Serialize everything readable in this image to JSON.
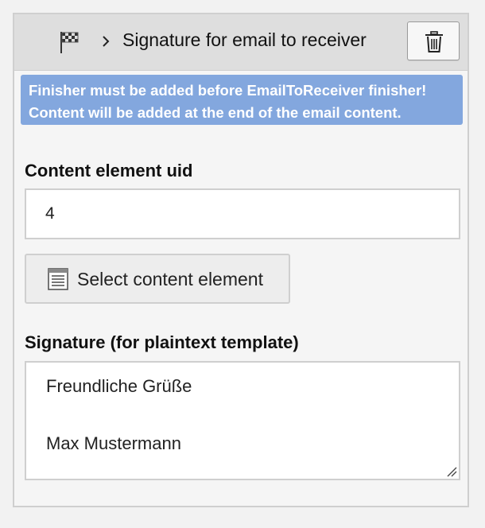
{
  "header": {
    "title": "Signature for email to receiver",
    "flag_icon": "checkered-flag-icon",
    "chevron_icon": "chevron-right-icon",
    "delete_icon": "trash-icon"
  },
  "notice": {
    "line1": "Finisher must be added before EmailToReceiver finisher!",
    "line2": "Content will be added at the end of the email content.",
    "background_color": "#83a7de"
  },
  "content_element": {
    "label": "Content element uid",
    "value": "4",
    "select_button_label": "Select content element",
    "select_icon": "document-icon"
  },
  "signature": {
    "label": "Signature (for plaintext template)",
    "line1": "Freundliche Grüße",
    "line2": "Max Mustermann",
    "resize_icon": "resize-handle-icon"
  }
}
